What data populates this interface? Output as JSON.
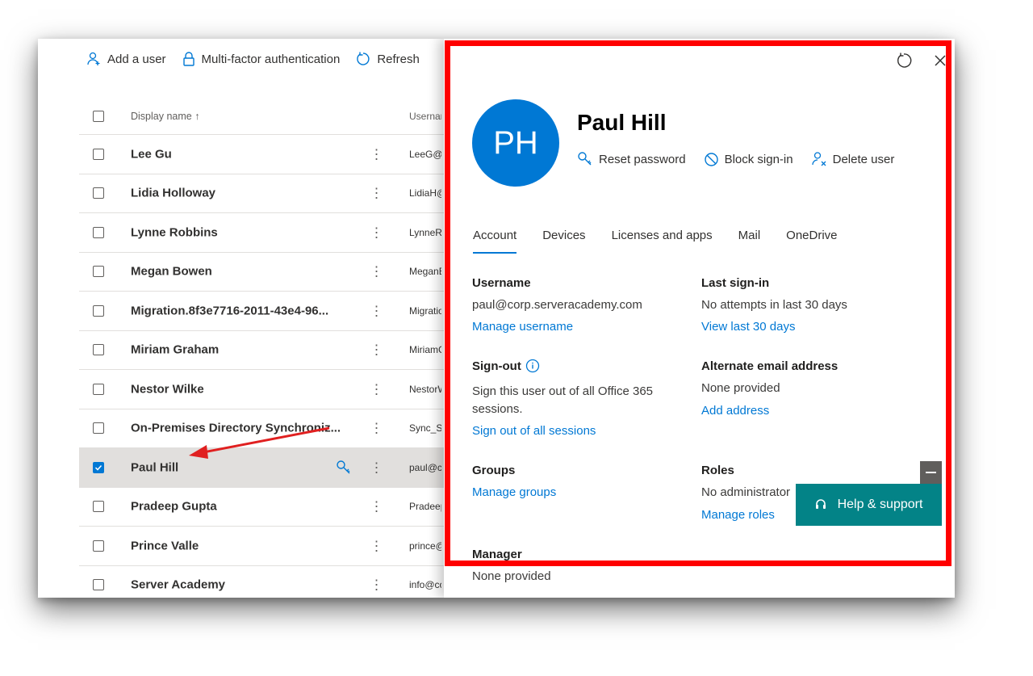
{
  "toolbar": {
    "add_user": "Add a user",
    "mfa": "Multi-factor authentication",
    "refresh": "Refresh"
  },
  "list": {
    "header": {
      "display_name": "Display name ↑",
      "username": "Usernar"
    },
    "rows": [
      {
        "name": "Lee Gu",
        "username": "LeeG@c",
        "selected": false
      },
      {
        "name": "Lidia Holloway",
        "username": "LidiaH@",
        "selected": false
      },
      {
        "name": "Lynne Robbins",
        "username": "LynneRo",
        "selected": false
      },
      {
        "name": "Megan Bowen",
        "username": "MeganB",
        "selected": false
      },
      {
        "name": "Migration.8f3e7716-2011-43e4-96...",
        "username": "Migratio",
        "selected": false
      },
      {
        "name": "Miriam Graham",
        "username": "MiriamG",
        "selected": false
      },
      {
        "name": "Nestor Wilke",
        "username": "NestorW",
        "selected": false
      },
      {
        "name": "On-Premises Directory Synchroniz...",
        "username": "Sync_SA",
        "selected": false
      },
      {
        "name": "Paul Hill",
        "username": "paul@c",
        "selected": true
      },
      {
        "name": "Pradeep Gupta",
        "username": "Pradeep",
        "selected": false
      },
      {
        "name": "Prince Valle",
        "username": "prince@",
        "selected": false
      },
      {
        "name": "Server Academy",
        "username": "info@cc",
        "selected": false
      }
    ]
  },
  "panel": {
    "initials": "PH",
    "user_name": "Paul Hill",
    "actions": {
      "reset_password": "Reset password",
      "block_sign_in": "Block sign-in",
      "delete_user": "Delete user"
    },
    "tabs": [
      "Account",
      "Devices",
      "Licenses and apps",
      "Mail",
      "OneDrive"
    ],
    "username": {
      "label": "Username",
      "value": "paul@corp.serveracademy.com",
      "link": "Manage username"
    },
    "last_sign_in": {
      "label": "Last sign-in",
      "value": "No attempts in last 30 days",
      "link": "View last 30 days"
    },
    "sign_out": {
      "label": "Sign-out",
      "value_line1": "Sign this user out of all Office 365",
      "value_line2": "sessions.",
      "link": "Sign out of all sessions"
    },
    "alt_email": {
      "label": "Alternate email address",
      "value": "None provided",
      "link": "Add address"
    },
    "groups": {
      "label": "Groups",
      "link": "Manage groups"
    },
    "roles": {
      "label": "Roles",
      "value": "No administrator",
      "link": "Manage roles"
    },
    "manager": {
      "label": "Manager",
      "value": "None provided"
    }
  },
  "help": {
    "label": "Help & support"
  },
  "colors": {
    "accent": "#0078d4",
    "highlight": "#ff0000",
    "help": "#038387"
  }
}
